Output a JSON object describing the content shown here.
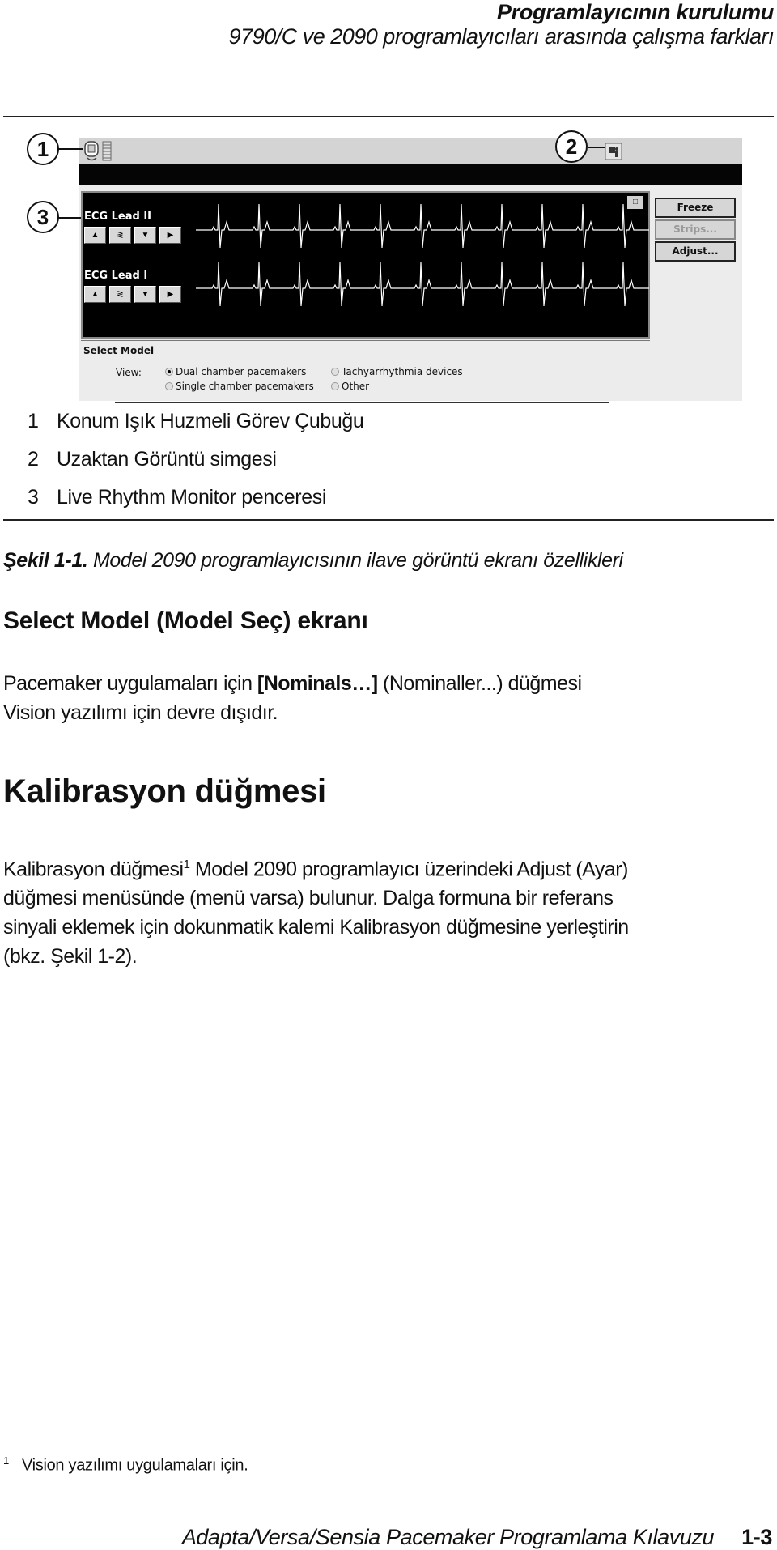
{
  "header": {
    "title": "Programlayıcının kurulumu",
    "subtitle": "9790/C ve 2090 programlayıcıları arasında çalışma farkları"
  },
  "figure": {
    "callouts": [
      "1",
      "2",
      "3"
    ],
    "taskbar_icons": [
      "position-lightbeam-icon",
      "remote-view-icon"
    ],
    "ecg_window": {
      "leads": [
        {
          "label": "ECG Lead II",
          "controls": [
            "▲",
            "≷",
            "▼",
            "▶"
          ]
        },
        {
          "label": "ECG Lead I",
          "controls": [
            "▲",
            "≷",
            "▼",
            "▶"
          ]
        }
      ],
      "mini_button": "□"
    },
    "side_buttons": [
      {
        "label": "Freeze",
        "enabled": true
      },
      {
        "label": "Strips...",
        "enabled": false
      },
      {
        "label": "Adjust...",
        "enabled": true
      }
    ],
    "select_model": {
      "title": "Select Model",
      "view_label": "View:",
      "options": [
        {
          "label": "Dual chamber pacemakers",
          "selected": true
        },
        {
          "label": "Single chamber pacemakers",
          "selected": false
        },
        {
          "label": "Tachyarrhythmia devices",
          "selected": false
        },
        {
          "label": "Other",
          "selected": false
        }
      ]
    }
  },
  "legend": [
    {
      "num": "1",
      "text": "Konum Işık Huzmeli Görev Çubuğu"
    },
    {
      "num": "2",
      "text": "Uzaktan Görüntü simgesi"
    },
    {
      "num": "3",
      "text": "Live Rhythm Monitor penceresi"
    }
  ],
  "caption": {
    "label": "Şekil 1-1.",
    "text": " Model 2090 programlayıcısının ilave görüntü ekranı özellikleri"
  },
  "section1": {
    "heading": "Select Model (Model Seç) ekranı",
    "line1_pre": "Pacemaker uygulamaları için ",
    "line1_bold": "[Nominals…]",
    "line1_post": " (Nominaller...) düğmesi",
    "line2": "Vision yazılımı için devre dışıdır."
  },
  "section2": {
    "heading": "Kalibrasyon düğmesi",
    "p_start": "Kalibrasyon düğmesi",
    "p_sup": "1",
    "p_line1_rest": " Model 2090 programlayıcı üzerindeki Adjust (Ayar)",
    "p_line2": "düğmesi menüsünde (menü varsa) bulunur. Dalga formuna bir referans",
    "p_line3": "sinyali eklemek için dokunmatik kalemi Kalibrasyon düğmesine yerleştirin",
    "p_line4": "(bkz. Şekil 1-2)."
  },
  "footnote": {
    "num": "1",
    "text": "Vision yazılımı uygulamaları için."
  },
  "footer": {
    "title": "Adapta/Versa/Sensia Pacemaker Programlama Kılavuzu",
    "page": "1-3"
  }
}
